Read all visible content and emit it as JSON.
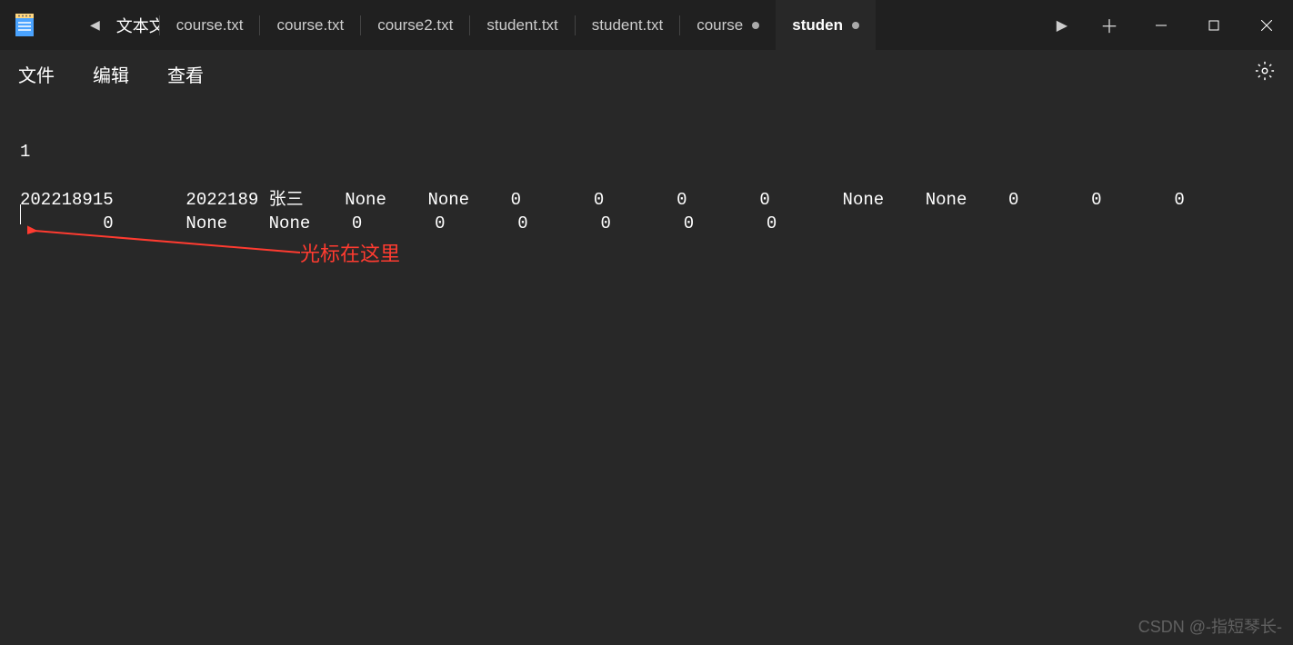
{
  "titlebar": {
    "first_tab_partial": "文本文",
    "tabs": [
      {
        "label": "course.txt",
        "dirty": false,
        "active": false
      },
      {
        "label": "course.txt",
        "dirty": false,
        "active": false
      },
      {
        "label": "course2.txt",
        "dirty": false,
        "active": false
      },
      {
        "label": "student.txt",
        "dirty": false,
        "active": false
      },
      {
        "label": "student.txt",
        "dirty": false,
        "active": false
      },
      {
        "label": "course",
        "dirty": true,
        "active": false
      },
      {
        "label": "studen",
        "dirty": true,
        "active": true
      }
    ]
  },
  "menubar": {
    "file": "文件",
    "edit": "编辑",
    "view": "查看"
  },
  "editor": {
    "line1": "1",
    "line2": "",
    "line3": "202218915       2022189 张三    None    None    0       0       0       0       None    None    0       0       0",
    "line4": "        0       None    None    0       0       0       0       0       0"
  },
  "annotation": {
    "text": "光标在这里"
  },
  "watermark": "CSDN @-指短琴长-"
}
